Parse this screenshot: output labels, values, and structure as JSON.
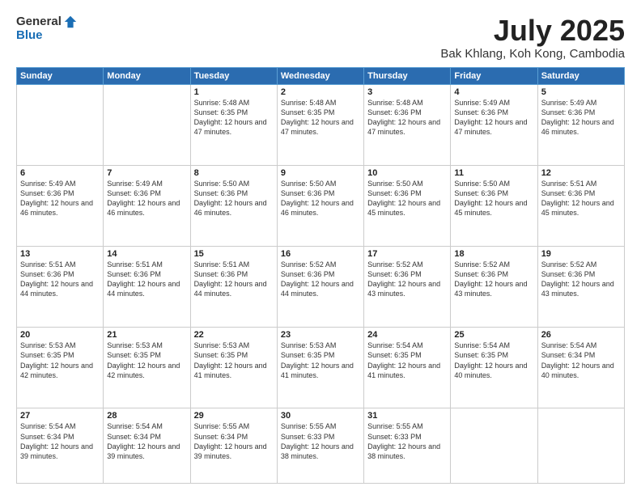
{
  "header": {
    "logo_general": "General",
    "logo_blue": "Blue",
    "month_title": "July 2025",
    "location": "Bak Khlang, Koh Kong, Cambodia"
  },
  "weekdays": [
    "Sunday",
    "Monday",
    "Tuesday",
    "Wednesday",
    "Thursday",
    "Friday",
    "Saturday"
  ],
  "weeks": [
    [
      {
        "day": "",
        "info": ""
      },
      {
        "day": "",
        "info": ""
      },
      {
        "day": "1",
        "info": "Sunrise: 5:48 AM\nSunset: 6:35 PM\nDaylight: 12 hours and 47 minutes."
      },
      {
        "day": "2",
        "info": "Sunrise: 5:48 AM\nSunset: 6:35 PM\nDaylight: 12 hours and 47 minutes."
      },
      {
        "day": "3",
        "info": "Sunrise: 5:48 AM\nSunset: 6:36 PM\nDaylight: 12 hours and 47 minutes."
      },
      {
        "day": "4",
        "info": "Sunrise: 5:49 AM\nSunset: 6:36 PM\nDaylight: 12 hours and 47 minutes."
      },
      {
        "day": "5",
        "info": "Sunrise: 5:49 AM\nSunset: 6:36 PM\nDaylight: 12 hours and 46 minutes."
      }
    ],
    [
      {
        "day": "6",
        "info": "Sunrise: 5:49 AM\nSunset: 6:36 PM\nDaylight: 12 hours and 46 minutes."
      },
      {
        "day": "7",
        "info": "Sunrise: 5:49 AM\nSunset: 6:36 PM\nDaylight: 12 hours and 46 minutes."
      },
      {
        "day": "8",
        "info": "Sunrise: 5:50 AM\nSunset: 6:36 PM\nDaylight: 12 hours and 46 minutes."
      },
      {
        "day": "9",
        "info": "Sunrise: 5:50 AM\nSunset: 6:36 PM\nDaylight: 12 hours and 46 minutes."
      },
      {
        "day": "10",
        "info": "Sunrise: 5:50 AM\nSunset: 6:36 PM\nDaylight: 12 hours and 45 minutes."
      },
      {
        "day": "11",
        "info": "Sunrise: 5:50 AM\nSunset: 6:36 PM\nDaylight: 12 hours and 45 minutes."
      },
      {
        "day": "12",
        "info": "Sunrise: 5:51 AM\nSunset: 6:36 PM\nDaylight: 12 hours and 45 minutes."
      }
    ],
    [
      {
        "day": "13",
        "info": "Sunrise: 5:51 AM\nSunset: 6:36 PM\nDaylight: 12 hours and 44 minutes."
      },
      {
        "day": "14",
        "info": "Sunrise: 5:51 AM\nSunset: 6:36 PM\nDaylight: 12 hours and 44 minutes."
      },
      {
        "day": "15",
        "info": "Sunrise: 5:51 AM\nSunset: 6:36 PM\nDaylight: 12 hours and 44 minutes."
      },
      {
        "day": "16",
        "info": "Sunrise: 5:52 AM\nSunset: 6:36 PM\nDaylight: 12 hours and 44 minutes."
      },
      {
        "day": "17",
        "info": "Sunrise: 5:52 AM\nSunset: 6:36 PM\nDaylight: 12 hours and 43 minutes."
      },
      {
        "day": "18",
        "info": "Sunrise: 5:52 AM\nSunset: 6:36 PM\nDaylight: 12 hours and 43 minutes."
      },
      {
        "day": "19",
        "info": "Sunrise: 5:52 AM\nSunset: 6:36 PM\nDaylight: 12 hours and 43 minutes."
      }
    ],
    [
      {
        "day": "20",
        "info": "Sunrise: 5:53 AM\nSunset: 6:35 PM\nDaylight: 12 hours and 42 minutes."
      },
      {
        "day": "21",
        "info": "Sunrise: 5:53 AM\nSunset: 6:35 PM\nDaylight: 12 hours and 42 minutes."
      },
      {
        "day": "22",
        "info": "Sunrise: 5:53 AM\nSunset: 6:35 PM\nDaylight: 12 hours and 41 minutes."
      },
      {
        "day": "23",
        "info": "Sunrise: 5:53 AM\nSunset: 6:35 PM\nDaylight: 12 hours and 41 minutes."
      },
      {
        "day": "24",
        "info": "Sunrise: 5:54 AM\nSunset: 6:35 PM\nDaylight: 12 hours and 41 minutes."
      },
      {
        "day": "25",
        "info": "Sunrise: 5:54 AM\nSunset: 6:35 PM\nDaylight: 12 hours and 40 minutes."
      },
      {
        "day": "26",
        "info": "Sunrise: 5:54 AM\nSunset: 6:34 PM\nDaylight: 12 hours and 40 minutes."
      }
    ],
    [
      {
        "day": "27",
        "info": "Sunrise: 5:54 AM\nSunset: 6:34 PM\nDaylight: 12 hours and 39 minutes."
      },
      {
        "day": "28",
        "info": "Sunrise: 5:54 AM\nSunset: 6:34 PM\nDaylight: 12 hours and 39 minutes."
      },
      {
        "day": "29",
        "info": "Sunrise: 5:55 AM\nSunset: 6:34 PM\nDaylight: 12 hours and 39 minutes."
      },
      {
        "day": "30",
        "info": "Sunrise: 5:55 AM\nSunset: 6:33 PM\nDaylight: 12 hours and 38 minutes."
      },
      {
        "day": "31",
        "info": "Sunrise: 5:55 AM\nSunset: 6:33 PM\nDaylight: 12 hours and 38 minutes."
      },
      {
        "day": "",
        "info": ""
      },
      {
        "day": "",
        "info": ""
      }
    ]
  ]
}
